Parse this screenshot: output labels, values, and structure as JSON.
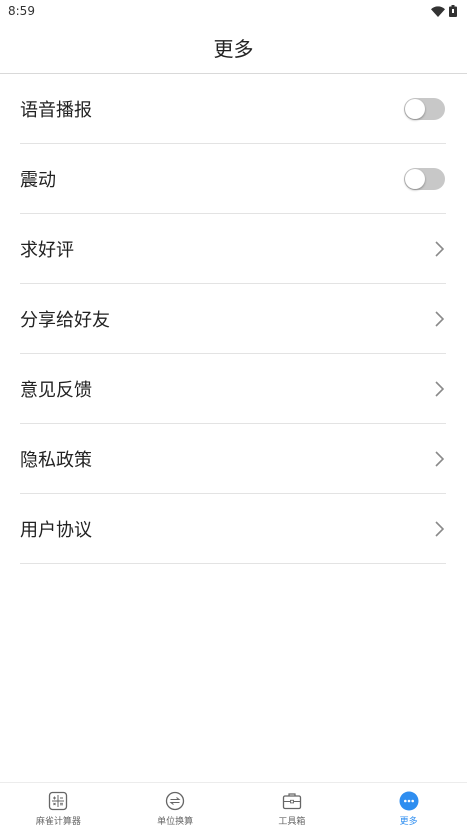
{
  "status_bar": {
    "time": "8:59",
    "icons": [
      "wifi-icon",
      "battery-icon"
    ]
  },
  "header": {
    "title": "更多"
  },
  "settings": {
    "voice_broadcast": {
      "label": "语音播报",
      "enabled": false
    },
    "vibration": {
      "label": "震动",
      "enabled": false
    },
    "rate_us": {
      "label": "求好评"
    },
    "share": {
      "label": "分享给好友"
    },
    "feedback": {
      "label": "意见反馈"
    },
    "privacy": {
      "label": "隐私政策"
    },
    "user_agreement": {
      "label": "用户协议"
    }
  },
  "tabs": [
    {
      "label": "麻雀计算器",
      "icon": "calculator-icon",
      "active": false
    },
    {
      "label": "单位换算",
      "icon": "convert-icon",
      "active": false
    },
    {
      "label": "工具箱",
      "icon": "toolbox-icon",
      "active": false
    },
    {
      "label": "更多",
      "icon": "more-icon",
      "active": true
    }
  ],
  "colors": {
    "accent": "#2f8ef0",
    "toggle_off": "#c8c8c8",
    "divider": "#e3e3e3"
  }
}
